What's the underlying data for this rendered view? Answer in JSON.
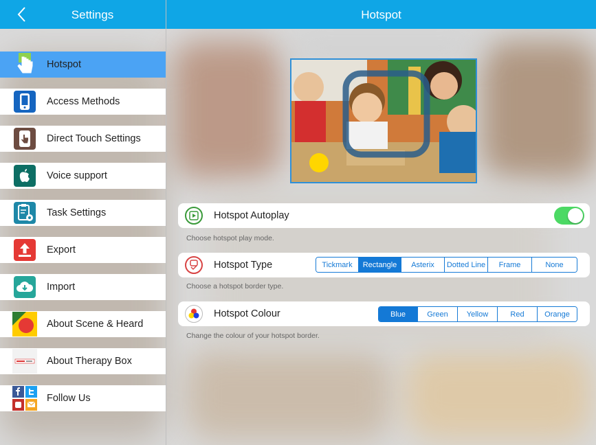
{
  "sidebar": {
    "title": "Settings",
    "back_icon": "chevron-left-icon",
    "items": [
      {
        "label": "Hotspot",
        "icon": "hand-pointer-icon",
        "active": true
      },
      {
        "label": "Access Methods",
        "icon": "tablet-icon"
      },
      {
        "label": "Direct Touch Settings",
        "icon": "touch-tablet-icon"
      },
      {
        "label": "Voice support",
        "icon": "apple-icon"
      },
      {
        "label": "Task Settings",
        "icon": "clipboard-gear-icon"
      },
      {
        "label": "Export",
        "icon": "upload-icon"
      },
      {
        "label": "Import",
        "icon": "cloud-download-icon"
      },
      {
        "label": "About Scene & Heard",
        "icon": "scene-heard-logo-icon"
      },
      {
        "label": "About Therapy Box",
        "icon": "therapy-box-logo-icon"
      },
      {
        "label": "Follow Us",
        "icon": "social-icons"
      }
    ]
  },
  "main": {
    "title": "Hotspot",
    "autoplay": {
      "label": "Hotspot Autoplay",
      "hint": "Choose hotspot play mode.",
      "enabled": true
    },
    "type": {
      "label": "Hotspot Type",
      "hint": "Choose a hotspot border type.",
      "options": [
        "Tickmark",
        "Rectangle",
        "Asterix",
        "Dotted Line",
        "Frame",
        "None"
      ],
      "selected": "Rectangle"
    },
    "colour": {
      "label": "Hotspot Colour",
      "hint": "Change the colour of your hotspot border.",
      "options": [
        "Blue",
        "Green",
        "Yellow",
        "Red",
        "Orange"
      ],
      "selected": "Blue"
    }
  },
  "colors": {
    "accent": "#0fa6e6",
    "active_row": "#4ba3f4",
    "segment_blue": "#1479d6",
    "toggle_on": "#4cd964"
  }
}
